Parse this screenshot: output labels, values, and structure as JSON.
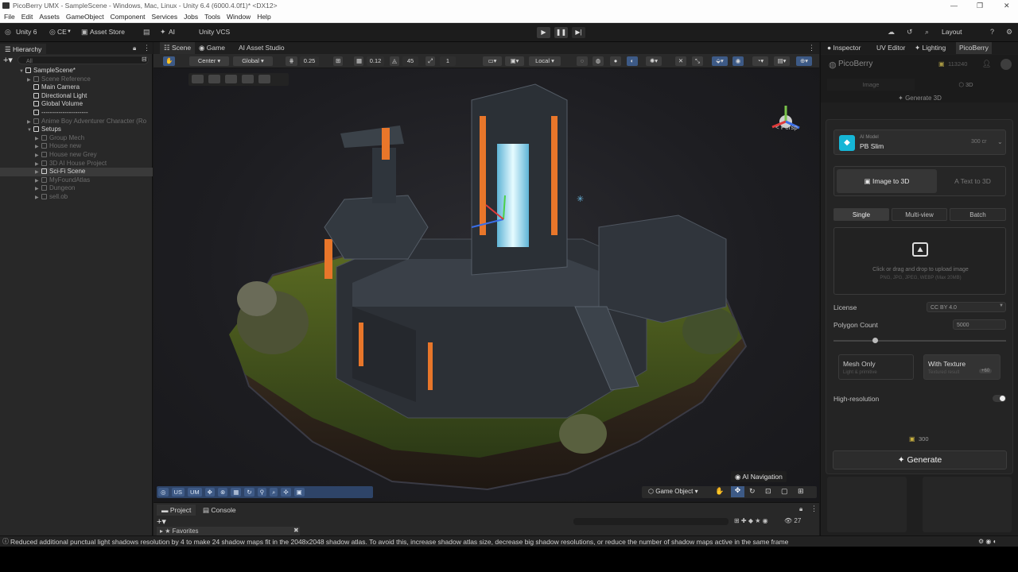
{
  "window": {
    "title": "PicoBerry UMX - SampleScene - Windows, Mac, Linux - Unity 6.4 (6000.4.0f1)* <DX12>"
  },
  "menu": [
    "File",
    "Edit",
    "Assets",
    "GameObject",
    "Component",
    "Services",
    "Jobs",
    "Tools",
    "Window",
    "Help"
  ],
  "toolbar": {
    "unity": "Unity 6",
    "ce": "CE",
    "asset_store": "Asset Store",
    "ai": "AI",
    "vcs": "Unity VCS",
    "layout": "Layout"
  },
  "hierarchy": {
    "tab": "Hierarchy",
    "search_placeholder": "All",
    "items": [
      {
        "label": "SampleScene*",
        "dim": false
      },
      {
        "label": "Scene Reference",
        "dim": true
      },
      {
        "label": "Main Camera",
        "dim": false
      },
      {
        "label": "Directional Light",
        "dim": false
      },
      {
        "label": "Global Volume",
        "dim": false
      },
      {
        "label": "----------------------",
        "dim": false
      },
      {
        "label": "Anime Boy Adventurer Character (Ro",
        "dim": true
      },
      {
        "label": "Setups",
        "dim": false
      },
      {
        "label": "Group Mech",
        "dim": true
      },
      {
        "label": "House new",
        "dim": true
      },
      {
        "label": "House new Grey",
        "dim": true
      },
      {
        "label": "3D AI House Project",
        "dim": true
      },
      {
        "label": "Sci-Fi Scene",
        "dim": false
      },
      {
        "label": "MyFoundAtlas",
        "dim": true
      },
      {
        "label": "Dungeon",
        "dim": true
      },
      {
        "label": "sell.ob",
        "dim": true
      }
    ]
  },
  "scene": {
    "tabs": [
      "Scene",
      "Game",
      "AI Asset Studio"
    ],
    "pivot": "Center",
    "space": "Global",
    "snap_value": "0.25",
    "snap2": "0.12",
    "angle": "45",
    "scale": "1",
    "local": "Local",
    "persp": "< Persp",
    "ai_navigation": "AI Navigation",
    "game_object": "Game Object",
    "bottom_tools": [
      "US",
      "UM"
    ]
  },
  "project": {
    "tabs": [
      "Project",
      "Console"
    ],
    "favorites": "Favorites",
    "count": "27"
  },
  "right": {
    "tabs": [
      "Inspector",
      "UV Editor",
      "Lighting",
      "PicoBerry"
    ],
    "brand": "PicoBerry",
    "credits": "113240",
    "sub_tabs": [
      "Image",
      "3D"
    ],
    "generate3d": "Generate 3D",
    "model_caption": "AI Model",
    "model": "PB Slim",
    "model_cost": "300 cr",
    "modes": [
      "Image to 3D",
      "Text to 3D"
    ],
    "views": [
      "Single",
      "Multi-view",
      "Batch"
    ],
    "upload_text": "Click or drag and drop to upload image",
    "upload_formats": "PNG, JPG, JPEG, WEBP (Max 20MB)",
    "license_label": "License",
    "license_value": "CC BY 4.0",
    "polycount_label": "Polygon Count",
    "polycount_value": "5000",
    "polycount_fraction": 0.24,
    "mesh_only": "Mesh Only",
    "mesh_only_sub": "Light & primitive",
    "with_texture": "With Texture",
    "with_texture_sub": "Textured result",
    "with_texture_badge": "+60",
    "hires_label": "High-resolution",
    "cost": "300",
    "generate": "Generate"
  },
  "status": "Reduced additional punctual light shadows resolution by 4 to make 24 shadow maps fit in the 2048x2048 shadow atlas. To avoid this, increase shadow atlas size, decrease big shadow resolutions, or reduce the number of shadow maps active in the same frame",
  "colors": {
    "accent": "#3d5a86",
    "pb_icon": "#15b6d6",
    "orange": "#e8762a"
  }
}
